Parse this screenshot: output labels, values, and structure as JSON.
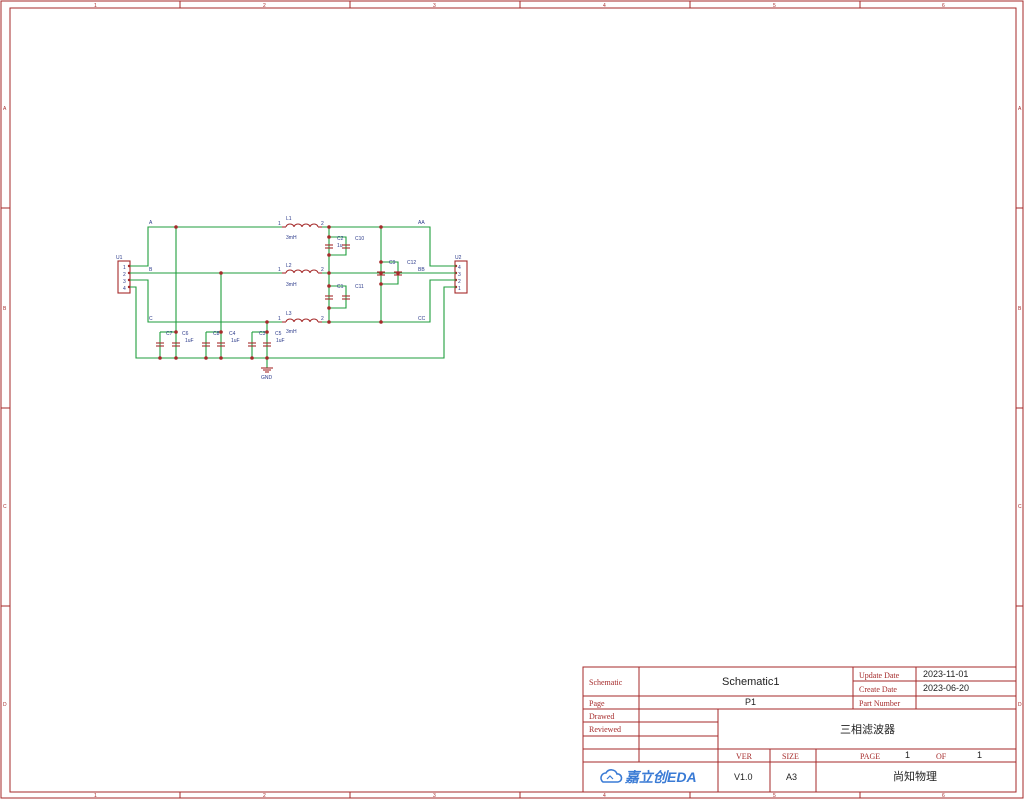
{
  "rulers": {
    "columns": [
      "1",
      "2",
      "3",
      "4",
      "5",
      "6"
    ],
    "rows": [
      "A",
      "B",
      "C",
      "D"
    ]
  },
  "schematic": {
    "connectors": {
      "left": {
        "ref": "U1",
        "pins": [
          "1",
          "2",
          "3",
          "4"
        ]
      },
      "right": {
        "ref": "U2",
        "pins": [
          "4",
          "3",
          "2",
          "1"
        ]
      }
    },
    "nets": {
      "a": "A",
      "b": "B",
      "c": "C",
      "aa": "AA",
      "bb": "BB",
      "cc": "CC",
      "gnd": "GND"
    },
    "inductors": [
      {
        "ref": "L1",
        "value": "3mH",
        "pin1": "1",
        "pin2": "2"
      },
      {
        "ref": "L2",
        "value": "3mH",
        "pin1": "1",
        "pin2": "2"
      },
      {
        "ref": "L3",
        "value": "3mH",
        "pin1": "1",
        "pin2": "2"
      }
    ],
    "capacitors": {
      "c1": "C1",
      "c2": "C2",
      "c2_value": "1u",
      "c3": "C3",
      "c4": "C4",
      "c4_value": "1uF",
      "c5": "C5",
      "c5_value": "1uF",
      "c6": "C6",
      "c6_value": "1uF",
      "c7": "C7",
      "c8": "C8",
      "c9": "C9",
      "c10": "C10",
      "c11": "C11",
      "c12": "C12"
    }
  },
  "title_block": {
    "schematic_label": "Schematic",
    "schematic_value": "Schematic1",
    "update_date_label": "Update Date",
    "update_date": "2023-11-01",
    "create_date_label": "Create Date",
    "create_date": "2023-06-20",
    "page_label": "Page",
    "page_value": "P1",
    "part_number_label": "Part Number",
    "drawed_label": "Drawed",
    "reviewed_label": "Reviewed",
    "title": "三相滤波器",
    "ver_label": "VER",
    "size_label": "SIZE",
    "page_caps_label": "PAGE",
    "page_num": "1",
    "of_label": "OF",
    "page_total": "1",
    "ver_value": "V1.0",
    "size_value": "A3",
    "company": "尚知物理",
    "logo_text": "嘉立创EDA"
  }
}
